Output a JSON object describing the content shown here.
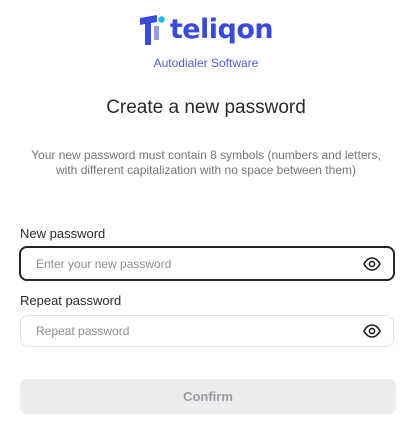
{
  "brand": {
    "logo_text": "teliqon",
    "tagline": "Autodialer Software",
    "color": "#3a4ad8"
  },
  "page": {
    "title": "Create a new password",
    "description": "Your new password must contain 8 symbols (numbers and letters, with different capitalization with no space between them)"
  },
  "form": {
    "new_password": {
      "label": "New password",
      "placeholder": "Enter your new password",
      "value": "",
      "toggle_icon": "eye-icon"
    },
    "repeat_password": {
      "label": "Repeat password",
      "placeholder": "Repeat password",
      "value": "",
      "toggle_icon": "eye-icon"
    },
    "confirm_label": "Confirm"
  }
}
